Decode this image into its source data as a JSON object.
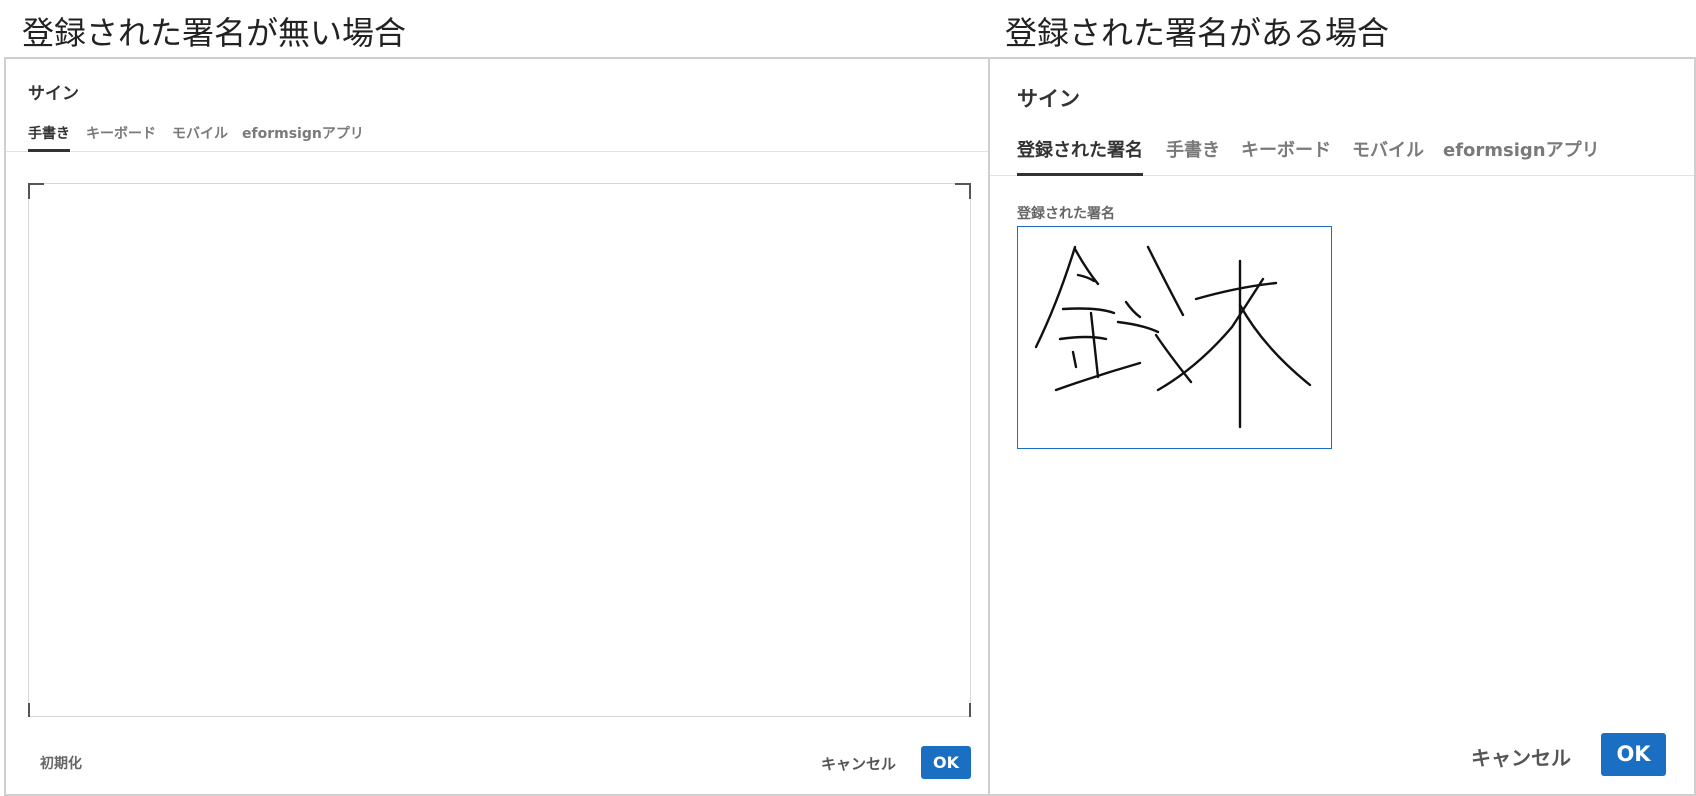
{
  "captions": {
    "left": "登録された署名が無い場合",
    "right": "登録された署名がある場合"
  },
  "left_dialog": {
    "title": "サイン",
    "tabs": [
      "手書き",
      "キーボード",
      "モバイル",
      "eformsignアプリ"
    ],
    "active_tab": "手書き",
    "reset_label": "初期化",
    "cancel_label": "キャンセル",
    "ok_label": "OK"
  },
  "right_dialog": {
    "title": "サイン",
    "tabs": [
      "登録された署名",
      "手書き",
      "キーボード",
      "モバイル",
      "eformsignアプリ"
    ],
    "active_tab": "登録された署名",
    "signature_label": "登録された署名",
    "cancel_label": "キャンセル",
    "ok_label": "OK"
  },
  "colors": {
    "accent": "#1b6fc2",
    "active_tab": "#333333",
    "inactive_tab": "#7a7a7a",
    "border": "#cfcfcf"
  }
}
